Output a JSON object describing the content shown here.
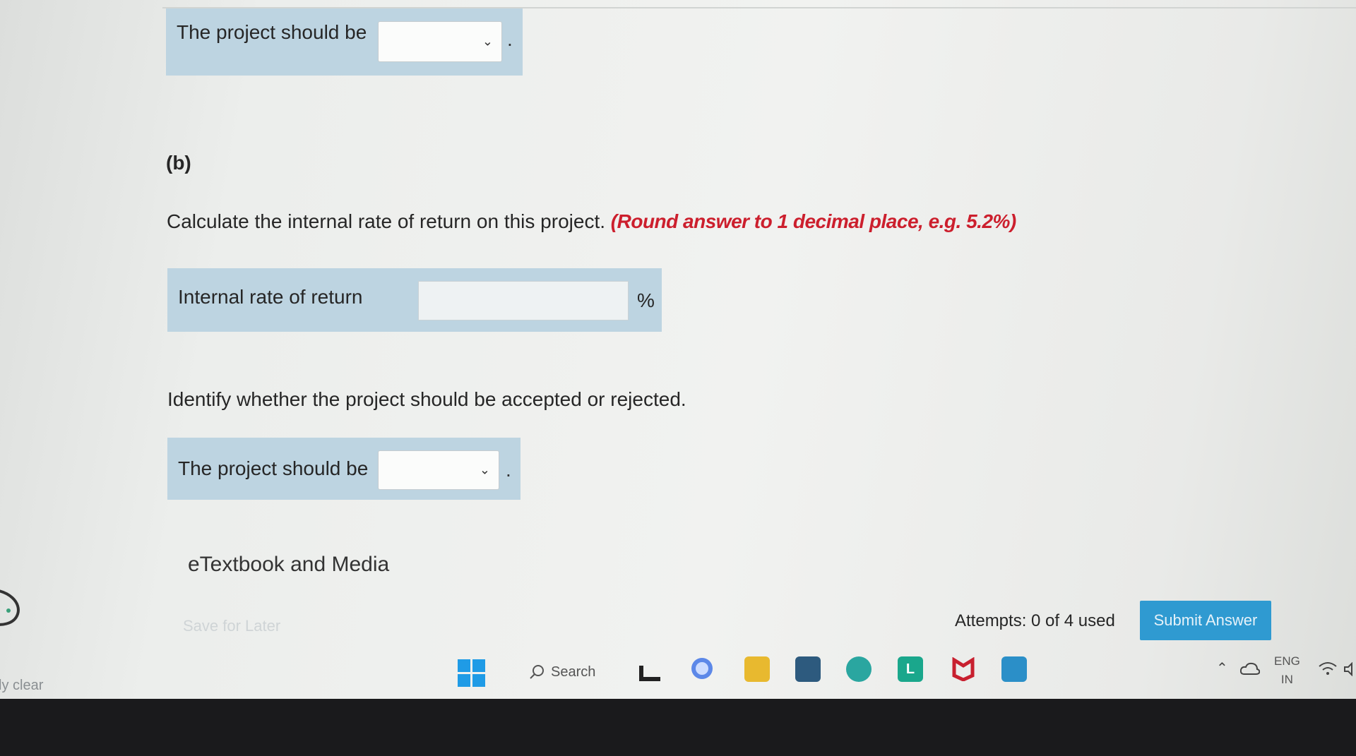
{
  "part_a": {
    "select_label": "The project should be",
    "select_value": "",
    "trailing": "."
  },
  "part_b": {
    "heading": "(b)",
    "question": "Calculate the internal rate of return on this project.",
    "note": "(Round answer to 1 decimal place, e.g. 5.2%)",
    "irr_label": "Internal rate of return",
    "irr_value": "",
    "irr_unit": "%",
    "identify_text": "Identify whether the project should be accepted or rejected.",
    "select_label": "The project should be",
    "select_value": "",
    "trailing": "."
  },
  "etextbook": "eTextbook and Media",
  "footer": {
    "save_label": "Save for Later",
    "attempts": "Attempts: 0 of 4 used",
    "submit_label": "Submit Answer"
  },
  "taskbar": {
    "weather_text": "ly clear",
    "search_label": "Search",
    "lang_primary": "ENG",
    "lang_secondary": "IN",
    "colors": {
      "accent": "#2f9ad1",
      "panel": "#bdd4e1",
      "note_red": "#cc1f2d"
    }
  }
}
